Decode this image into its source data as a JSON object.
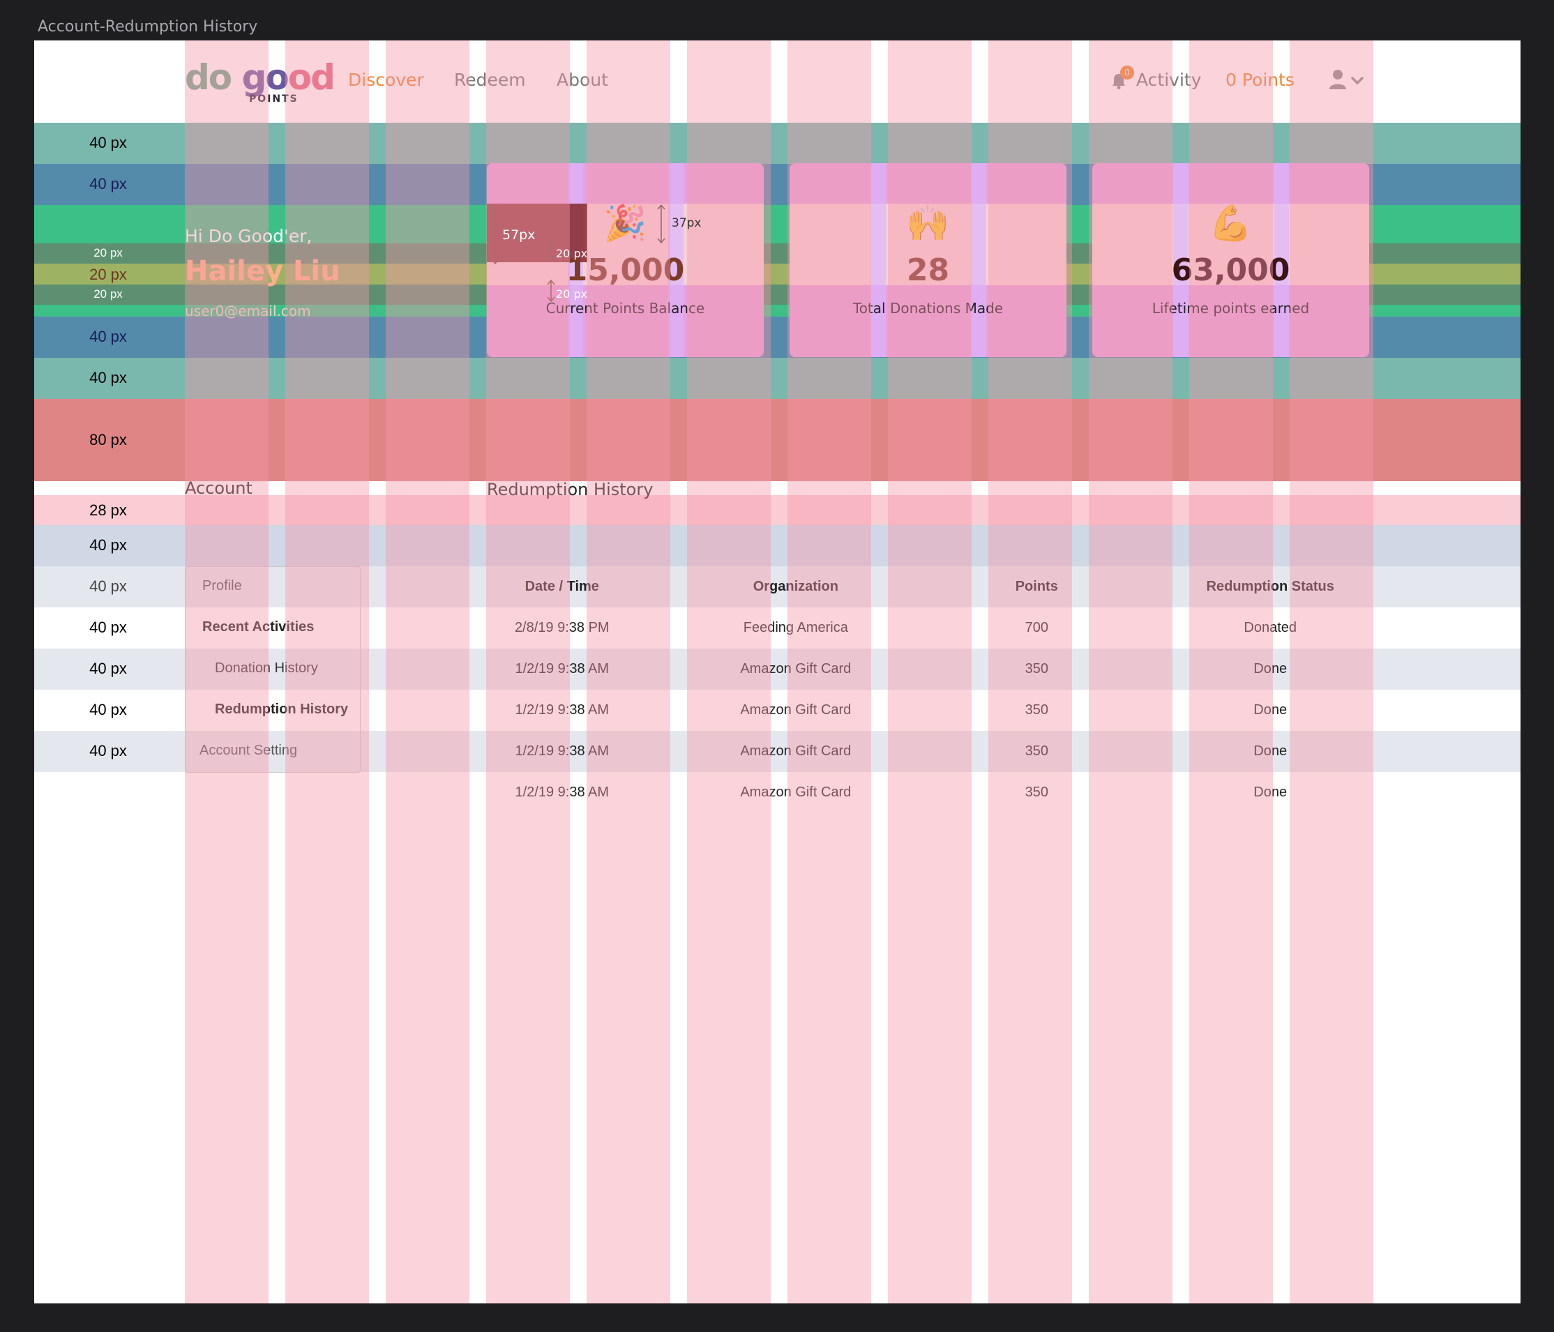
{
  "window": {
    "title": "Account-Redumption History"
  },
  "nav": {
    "logo_word_parts": [
      "do",
      " ",
      "go",
      "od"
    ],
    "logo_sub": "POINTS",
    "links": [
      "Discover",
      "Redeem",
      "About"
    ],
    "activity_label": "Activity",
    "activity_badge": "0",
    "points_label": "0 Points"
  },
  "profile": {
    "greeting": "Hi Do Good'er,",
    "name": "Hailey Liu",
    "email": "user0@email.com"
  },
  "stats": [
    {
      "emoji": "🎉",
      "value": "15,000",
      "label": "Current Points Balance"
    },
    {
      "emoji": "🙌",
      "value": "28",
      "label": "Total Donations Made"
    },
    {
      "emoji": "💪",
      "value": "63,000",
      "label": "Lifetime points earned"
    }
  ],
  "annotations": {
    "bands": [
      "40 px",
      "40 px",
      "20 px",
      "20 px",
      "20 px",
      "40 px",
      "40 px",
      "80 px",
      "28 px",
      "40 px",
      "40 px",
      "40 px",
      "40 px",
      "40 px",
      "40 px"
    ],
    "card_measure_1": "57px",
    "card_measure_2": "37px",
    "card_measure_3": "20 px",
    "card_measure_4": "20 px"
  },
  "sections": {
    "account_label": "Account",
    "history_label": "Redumption History"
  },
  "sidebar": {
    "items": [
      "Profile",
      "Recent Activities",
      "Donation History",
      "Redumption History",
      "Account Setting"
    ]
  },
  "table": {
    "headers": [
      "Date / Time",
      "Organization",
      "Points",
      "Redumption Status"
    ],
    "rows": [
      [
        "2/8/19 9:38 PM",
        "Feeding America",
        "700",
        "Donated"
      ],
      [
        "1/2/19 9:38 AM",
        "Amazon Gift Card",
        "350",
        "Done"
      ],
      [
        "1/2/19 9:38 AM",
        "Amazon Gift Card",
        "350",
        "Done"
      ],
      [
        "1/2/19 9:38 AM",
        "Amazon Gift Card",
        "350",
        "Done"
      ],
      [
        "1/2/19 9:38 AM",
        "Amazon Gift Card",
        "350",
        "Done"
      ]
    ]
  },
  "colors": {
    "accent": "#f0852d",
    "status_green": "#5fb36b",
    "column_overlay": "#f696aa"
  }
}
